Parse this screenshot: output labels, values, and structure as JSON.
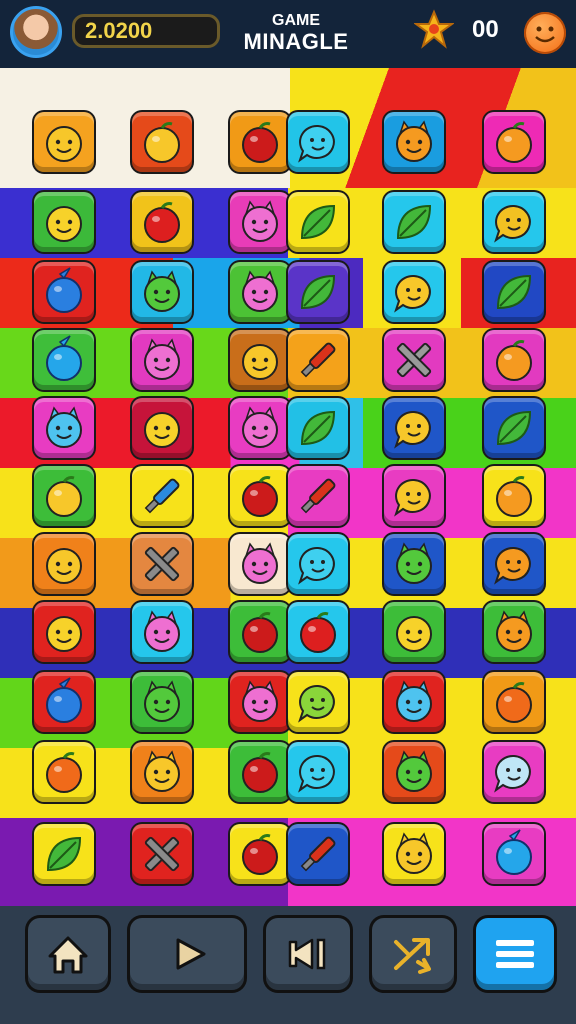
{
  "header": {
    "score": "2.0200",
    "title_top": "GAME",
    "title_bottom": "MINAGLE",
    "counter": "00",
    "icons": [
      "avatar-portrait",
      "star-trophy-icon",
      "smiley-face-icon"
    ]
  },
  "board": {
    "rows": 12,
    "cols": 6,
    "tile_types": [
      "smiley",
      "fruit",
      "cat",
      "bubble",
      "leaf",
      "drop",
      "tool",
      "crossed-tools"
    ],
    "tiles": [
      [
        {
          "c": "#f5a21f",
          "t": "smiley",
          "f": "#f7c72a"
        },
        {
          "c": "#e54a1a",
          "t": "fruit",
          "f": "#f7c72a"
        },
        {
          "c": "#f19a16",
          "t": "fruit",
          "f": "#cc1b1b"
        },
        {
          "c": "#22c4e8",
          "t": "bubble",
          "f": "#3fd0ef"
        },
        {
          "c": "#1a9de0",
          "t": "cat",
          "f": "#f59a20"
        },
        {
          "c": "#ee2ab5",
          "t": "fruit",
          "f": "#f59a20"
        }
      ],
      [
        {
          "c": "#3cb93a",
          "t": "smiley",
          "f": "#f7d22a"
        },
        {
          "c": "#f1c31a",
          "t": "fruit",
          "f": "#dd1f1f"
        },
        {
          "c": "#e83cb8",
          "t": "cat",
          "f": "#ee6fd1"
        },
        {
          "c": "#f7e21a",
          "t": "leaf",
          "f": "#43b83a"
        },
        {
          "c": "#25c7ec",
          "t": "leaf",
          "f": "#43b83a"
        },
        {
          "c": "#25c7ec",
          "t": "bubble",
          "f": "#f2c122"
        }
      ],
      [
        {
          "c": "#e0231f",
          "t": "drop",
          "f": "#2a7fe0"
        },
        {
          "c": "#22b8e6",
          "t": "cat",
          "f": "#53c93c"
        },
        {
          "c": "#4cc235",
          "t": "cat",
          "f": "#ee6fd1"
        },
        {
          "c": "#5a34c8",
          "t": "leaf",
          "f": "#43b83a"
        },
        {
          "c": "#25c7ec",
          "t": "bubble",
          "f": "#f7c72a"
        },
        {
          "c": "#2148c4",
          "t": "leaf",
          "f": "#43b83a"
        }
      ],
      [
        {
          "c": "#3fbe3a",
          "t": "drop",
          "f": "#25a6ea"
        },
        {
          "c": "#e23ac0",
          "t": "cat",
          "f": "#ee6fd1"
        },
        {
          "c": "#c96e1a",
          "t": "smiley",
          "f": "#f7c72a"
        },
        {
          "c": "#f4a21a",
          "t": "tool",
          "f": "#d9321b"
        },
        {
          "c": "#e23ac0",
          "t": "crossed-tools",
          "f": "#9a9a9a"
        },
        {
          "c": "#e23ac0",
          "t": "fruit",
          "f": "#f59a20"
        }
      ],
      [
        {
          "c": "#e83cc2",
          "t": "cat",
          "f": "#4ec3ef"
        },
        {
          "c": "#c6143a",
          "t": "smiley",
          "f": "#f7d22a"
        },
        {
          "c": "#e83cc2",
          "t": "cat",
          "f": "#ee6fd1"
        },
        {
          "c": "#22c0e6",
          "t": "leaf",
          "f": "#43b83a"
        },
        {
          "c": "#1f56c8",
          "t": "bubble",
          "f": "#f7c72a"
        },
        {
          "c": "#1f56c8",
          "t": "leaf",
          "f": "#43b83a"
        }
      ],
      [
        {
          "c": "#3dbd39",
          "t": "fruit",
          "f": "#f7c72a"
        },
        {
          "c": "#f7e21a",
          "t": "tool",
          "f": "#2a8ae0"
        },
        {
          "c": "#f7e21a",
          "t": "fruit",
          "f": "#cc1b1b"
        },
        {
          "c": "#e83cc2",
          "t": "tool",
          "f": "#d9321b"
        },
        {
          "c": "#e83cc2",
          "t": "bubble",
          "f": "#f7c72a"
        },
        {
          "c": "#f7e21a",
          "t": "fruit",
          "f": "#f59a20"
        }
      ],
      [
        {
          "c": "#f0811a",
          "t": "smiley",
          "f": "#f7c72a"
        },
        {
          "c": "#e48740",
          "t": "crossed-tools",
          "f": "#8a8a8a"
        },
        {
          "c": "#f8e8d0",
          "t": "cat",
          "f": "#ee6fd1"
        },
        {
          "c": "#25c7ec",
          "t": "bubble",
          "f": "#3fd0ef"
        },
        {
          "c": "#1f56c8",
          "t": "cat",
          "f": "#53c93c"
        },
        {
          "c": "#1f56c8",
          "t": "bubble",
          "f": "#f59a20"
        }
      ],
      [
        {
          "c": "#e0231f",
          "t": "smiley",
          "f": "#f7d22a"
        },
        {
          "c": "#25c7ec",
          "t": "cat",
          "f": "#ee6fd1"
        },
        {
          "c": "#3dbd39",
          "t": "fruit",
          "f": "#cc1b1b"
        },
        {
          "c": "#25c7ec",
          "t": "fruit",
          "f": "#dd1f1f"
        },
        {
          "c": "#3dbd39",
          "t": "smiley",
          "f": "#f7d22a"
        },
        {
          "c": "#3dbd39",
          "t": "cat",
          "f": "#f59a20"
        }
      ],
      [
        {
          "c": "#e0231f",
          "t": "drop",
          "f": "#2a7fe0"
        },
        {
          "c": "#3dbd39",
          "t": "cat",
          "f": "#53c93c"
        },
        {
          "c": "#e0231f",
          "t": "cat",
          "f": "#ee6fd1"
        },
        {
          "c": "#f7e21a",
          "t": "bubble",
          "f": "#8ad63a"
        },
        {
          "c": "#e0231f",
          "t": "cat",
          "f": "#4ec3ef"
        },
        {
          "c": "#f19a16",
          "t": "fruit",
          "f": "#f06a1a"
        }
      ],
      [
        {
          "c": "#f7e21a",
          "t": "fruit",
          "f": "#f06a1a"
        },
        {
          "c": "#f0811a",
          "t": "cat",
          "f": "#f7c72a"
        },
        {
          "c": "#3dbd39",
          "t": "fruit",
          "f": "#cc1b1b"
        },
        {
          "c": "#25c7ec",
          "t": "bubble",
          "f": "#3fd0ef"
        },
        {
          "c": "#e54a1a",
          "t": "cat",
          "f": "#53c93c"
        },
        {
          "c": "#e83cc2",
          "t": "bubble",
          "f": "#bfe6f6"
        }
      ],
      [
        {
          "c": "#f7e21a",
          "t": "leaf",
          "f": "#43b83a"
        },
        {
          "c": "#e0231f",
          "t": "crossed-tools",
          "f": "#8a8a8a"
        },
        {
          "c": "#f7e21a",
          "t": "fruit",
          "f": "#cc1b1b"
        },
        {
          "c": "#1f56c8",
          "t": "tool",
          "f": "#d9321b"
        },
        {
          "c": "#f7e21a",
          "t": "cat",
          "f": "#f7c72a"
        },
        {
          "c": "#e83cc2",
          "t": "drop",
          "f": "#25a6ea"
        }
      ]
    ]
  },
  "toolbar": {
    "buttons": [
      {
        "name": "home-button",
        "icon": "home-icon",
        "fill": "#3b4b5c"
      },
      {
        "name": "play-button",
        "icon": "play-icon",
        "fill": "#3b4b5c"
      },
      {
        "name": "skip-back-button",
        "icon": "skip-back-icon",
        "fill": "#3b4b5c"
      },
      {
        "name": "shuffle-button",
        "icon": "shuffle-icon",
        "fill": "#3b4b5c"
      },
      {
        "name": "menu-button",
        "icon": "menu-icon",
        "fill": "#1fa3f0"
      }
    ]
  }
}
